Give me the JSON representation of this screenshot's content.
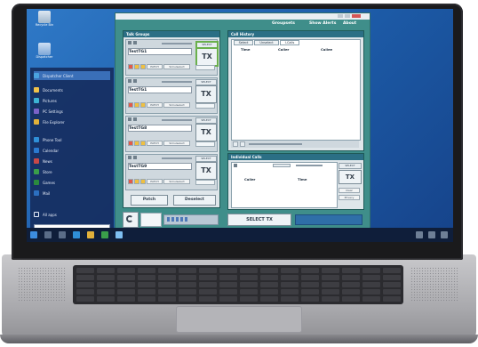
{
  "app": {
    "menu": [
      "Groupsets",
      "Show Alerts",
      "About"
    ],
    "panels": {
      "talk_groups": "Talk Groups",
      "call_history": "Call History",
      "individual_calls": "Individual Calls"
    },
    "talkgroups": [
      {
        "name": "TestTG1",
        "tx": "TX",
        "select": "SELECT",
        "highlighted": true
      },
      {
        "name": "TestTG1",
        "tx": "TX",
        "select": "SELECT",
        "highlighted": false
      },
      {
        "name": "TestTG8",
        "tx": "TX",
        "select": "SELECT",
        "highlighted": false
      },
      {
        "name": "TestTG9",
        "tx": "TX",
        "select": "SELECT",
        "highlighted": false
      }
    ],
    "tg_buttons": [
      "PATCH",
      "Simulselect"
    ],
    "call_tabs": [
      "Select",
      "Unselect",
      "I-Calls"
    ],
    "call_columns": [
      "Time",
      "Caller",
      "Callee"
    ],
    "ind_columns": [
      "Caller",
      "Time"
    ],
    "ind_select": "SELECT",
    "ind_tx": "TX",
    "ind_side_buttons": [
      "Clear",
      "Privacy"
    ],
    "patch_button": "Patch",
    "deselect_button": "Deselect",
    "select_tx_button": "SELECT TX",
    "status": "15:26:46 Initial programming complete (Port 3077)"
  },
  "desktop": {
    "icons": [
      "Recycle Bin",
      "Dispatcher"
    ]
  },
  "start_menu": {
    "items": [
      "Dispatcher Client",
      "Documents",
      "Pictures",
      "PC Settings",
      "File Explorer",
      "Phone Tool",
      "Calendar",
      "News",
      "Store",
      "Games",
      "Mail"
    ],
    "all_apps": "All apps"
  },
  "colors": {
    "app_frame": "#3f8e8a",
    "panel_head": "#2b6f85",
    "desktop": "#1d63b5",
    "select_ring": "#6ab04c"
  }
}
